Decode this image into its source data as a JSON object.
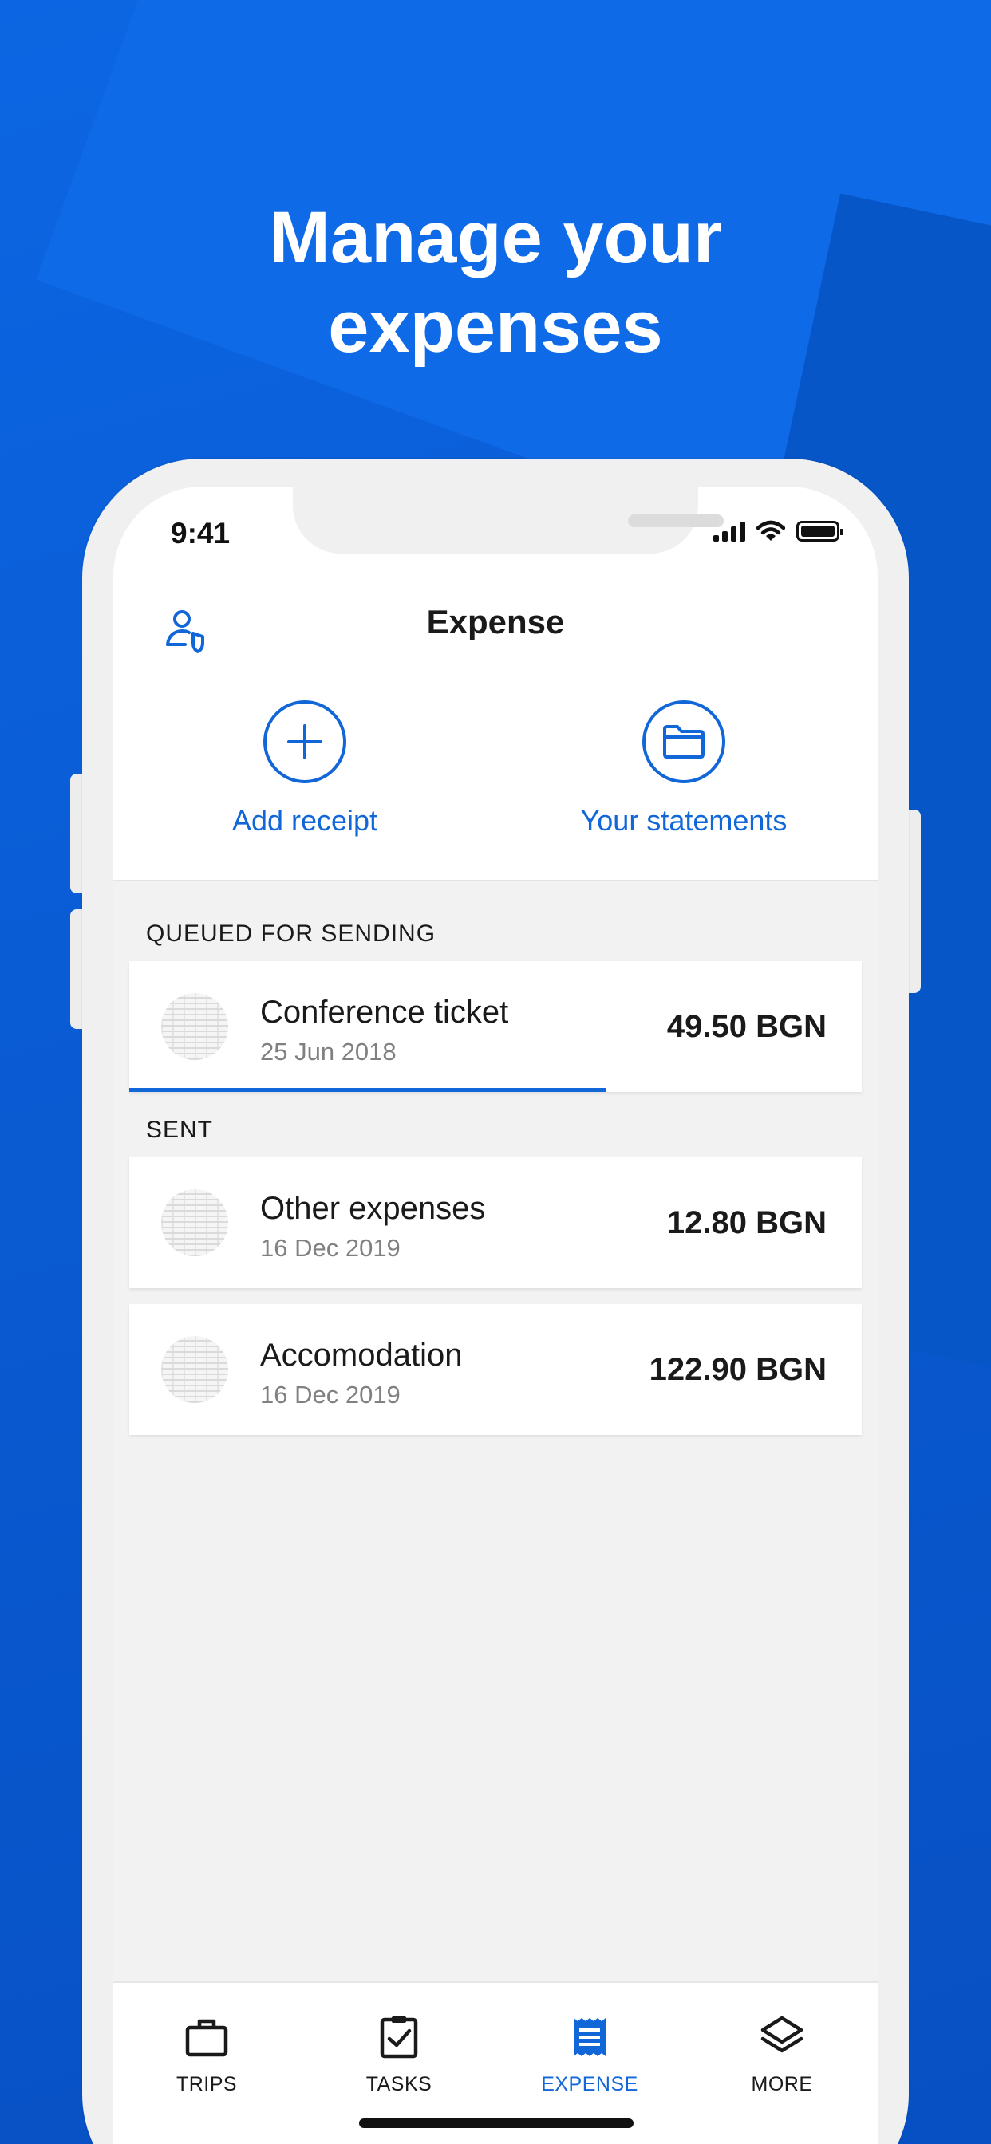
{
  "headline": {
    "line1": "Manage your",
    "line2": "expenses"
  },
  "status": {
    "time": "9:41"
  },
  "header": {
    "title": "Expense",
    "profile_icon": "user-shield-icon"
  },
  "actions": [
    {
      "label": "Add receipt",
      "icon": "plus-icon"
    },
    {
      "label": "Your statements",
      "icon": "folder-icon"
    }
  ],
  "sections": {
    "queued": {
      "label": "QUEUED FOR SENDING"
    },
    "sent": {
      "label": "SENT"
    }
  },
  "queued_items": [
    {
      "title": "Conference ticket",
      "date": "25 Jun 2018",
      "amount": "49.50 BGN",
      "upload_progress": 0.65
    }
  ],
  "sent_items": [
    {
      "title": "Other expenses",
      "date": "16 Dec 2019",
      "amount": "12.80 BGN"
    },
    {
      "title": "Accomodation",
      "date": "16 Dec 2019",
      "amount": "122.90 BGN"
    }
  ],
  "tabs": [
    {
      "label": "TRIPS",
      "icon": "briefcase-icon",
      "active": false
    },
    {
      "label": "TASKS",
      "icon": "clipboard-check-icon",
      "active": false
    },
    {
      "label": "EXPENSE",
      "icon": "receipt-icon",
      "active": true
    },
    {
      "label": "MORE",
      "icon": "layers-icon",
      "active": false
    }
  ],
  "colors": {
    "accent": "#1166d8",
    "background": "#0a5fd6"
  }
}
